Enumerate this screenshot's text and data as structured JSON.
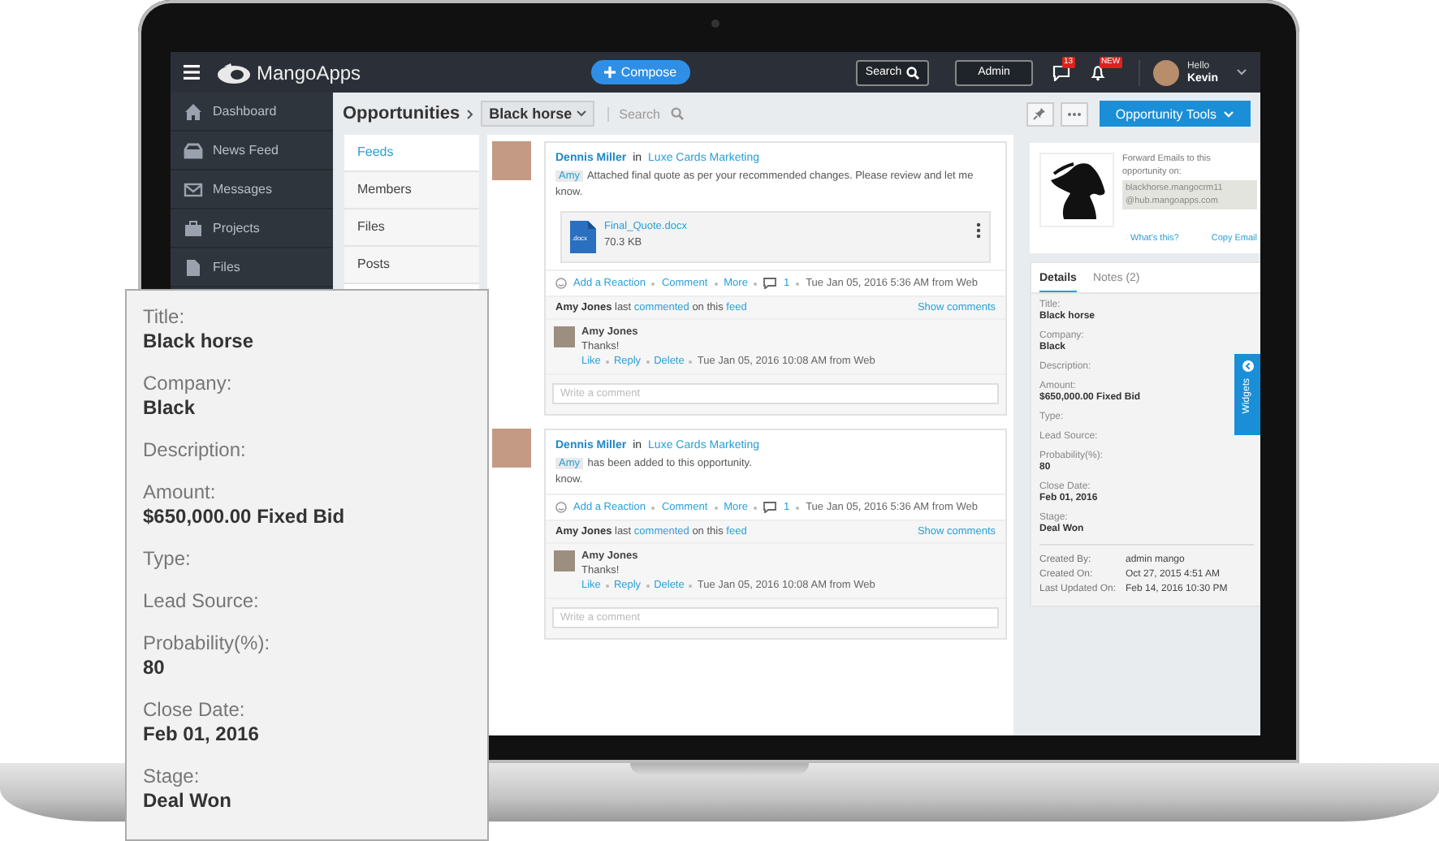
{
  "topbar": {
    "brand": "MangoApps",
    "compose": "Compose",
    "search": "Search",
    "admin": "Admin",
    "chat_badge": "13",
    "bell_badge": "NEW",
    "greeting": "Hello",
    "user": "Kevin"
  },
  "sidebar": {
    "items": [
      {
        "label": "Dashboard"
      },
      {
        "label": "News Feed"
      },
      {
        "label": "Messages"
      },
      {
        "label": "Projects"
      },
      {
        "label": "Files"
      }
    ]
  },
  "header": {
    "breadcrumb": "Opportunities",
    "record": "Black horse",
    "search_placeholder": "Search",
    "tools_button": "Opportunity Tools"
  },
  "tabs": [
    {
      "label": "Feeds",
      "selected": true
    },
    {
      "label": "Members",
      "selected": false
    },
    {
      "label": "Files",
      "selected": false
    },
    {
      "label": "Posts",
      "selected": false
    }
  ],
  "posts": [
    {
      "author": "Dennis Miller",
      "joiner": "in",
      "group": "Luxe Cards Marketing",
      "mention": "Amy",
      "text": "Attached final quote as per your recommended changes. Please review and let me know.",
      "attachment": {
        "name": "Final_Quote.docx",
        "size": "70.3 KB",
        "type": ".docx"
      },
      "actions": [
        "Add a Reaction",
        "Comment",
        "More"
      ],
      "comment_count": "1",
      "timestamp": "Tue Jan 05, 2016 5:36 AM from Web",
      "summary": {
        "name": "Amy Jones",
        "word1": "last",
        "link1": "commented",
        "word2": "on this",
        "link2": "feed"
      },
      "show_comments": "Show comments",
      "comment": {
        "author": "Amy Jones",
        "text": "Thanks!",
        "actions": [
          "Like",
          "Reply",
          "Delete"
        ],
        "timestamp": "Tue Jan 05, 2016 10:08 AM from Web"
      },
      "comment_placeholder": "Write a comment"
    },
    {
      "author": "Dennis Miller",
      "joiner": "in",
      "group": "Luxe Cards Marketing",
      "mention": "Amy",
      "text": "has been added to this opportunity.",
      "trailing_text": "know.",
      "actions": [
        "Add a Reaction",
        "Comment",
        "More"
      ],
      "comment_count": "1",
      "timestamp": "Tue Jan 05, 2016 5:36 AM from Web",
      "summary": {
        "name": "Amy Jones",
        "word1": "last",
        "link1": "commented",
        "word2": "on this",
        "link2": "feed"
      },
      "show_comments": "Show comments",
      "comment": {
        "author": "Amy Jones",
        "text": "Thanks!",
        "actions": [
          "Like",
          "Reply",
          "Delete"
        ],
        "timestamp": "Tue Jan 05, 2016 10:08 AM from Web"
      },
      "comment_placeholder": "Write a comment"
    }
  ],
  "email_card": {
    "text": "Forward Emails to this opportunity on:",
    "address_lines": [
      "blackhorse.mangocrm11",
      "@hub.mangoapps.com"
    ],
    "links": [
      "What's this?",
      "Copy Email"
    ]
  },
  "detail_tabs": [
    {
      "label": "Details",
      "selected": true
    },
    {
      "label": "Notes (2)",
      "selected": false
    }
  ],
  "details": [
    {
      "label": "Title:",
      "value": "Black horse"
    },
    {
      "label": "Company:",
      "value": "Black"
    },
    {
      "label": "Description:"
    },
    {
      "label": "Amount:",
      "value": "$650,000.00 Fixed Bid"
    },
    {
      "label": "Type:"
    },
    {
      "label": "Lead Source:"
    },
    {
      "label": "Probability(%):",
      "value": "80"
    },
    {
      "label": "Close Date:",
      "value": "Feb 01, 2016"
    },
    {
      "label": "Stage:",
      "value": "Deal Won"
    }
  ],
  "meta": [
    {
      "label": "Created By:",
      "value": "admin mango"
    },
    {
      "label": "Created On:",
      "value": "Oct 27, 2015 4:51 AM"
    },
    {
      "label": "Last Updated On:",
      "value": "Feb 14, 2016 10:30 PM"
    }
  ],
  "widgets_tab": "Widgets",
  "callout": {
    "fields": [
      {
        "label": "Title:",
        "value": "Black horse"
      },
      {
        "label": "Company:",
        "value": "Black"
      },
      {
        "label": "Description:"
      },
      {
        "label": "Amount:",
        "value": "$650,000.00 Fixed Bid"
      },
      {
        "label": "Type:"
      },
      {
        "label": "Lead Source:"
      },
      {
        "label": "Probability(%):",
        "value": "80"
      },
      {
        "label": "Close Date:",
        "value": "Feb 01, 2016"
      },
      {
        "label": "Stage:",
        "value": "Deal Won"
      }
    ]
  }
}
